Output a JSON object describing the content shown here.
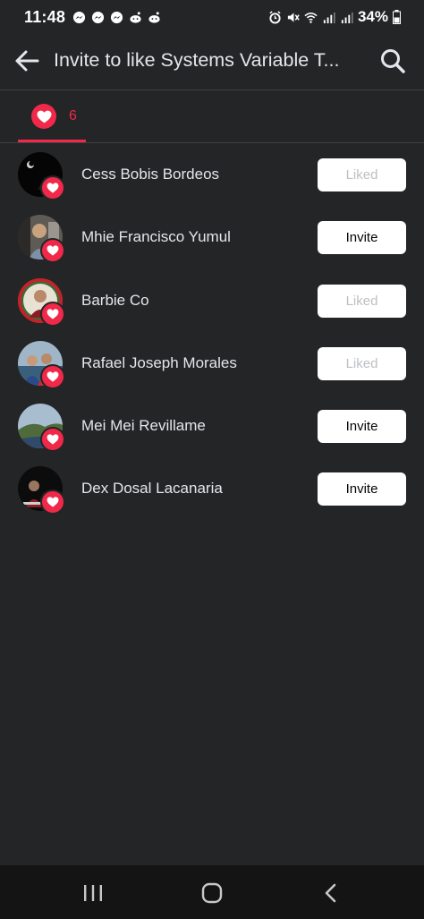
{
  "status_bar": {
    "time": "11:48",
    "battery_text": "34%"
  },
  "header": {
    "title": "Invite to like Systems Variable T..."
  },
  "tabs": [
    {
      "icon": "heart-icon",
      "count": "6"
    }
  ],
  "people": [
    {
      "name": "Cess Bobis Bordeos",
      "action": "Liked"
    },
    {
      "name": "Mhie Francisco Yumul",
      "action": "Invite"
    },
    {
      "name": "Barbie Co",
      "action": "Liked"
    },
    {
      "name": "Rafael Joseph Morales",
      "action": "Liked"
    },
    {
      "name": "Mei Mei Revillame",
      "action": "Invite"
    },
    {
      "name": "Dex Dosal Lacanaria",
      "action": "Invite"
    }
  ],
  "colors": {
    "background": "#242526",
    "accent": "#f02849",
    "button_bg": "#ffffff",
    "liked_text": "#bcc0c4"
  }
}
